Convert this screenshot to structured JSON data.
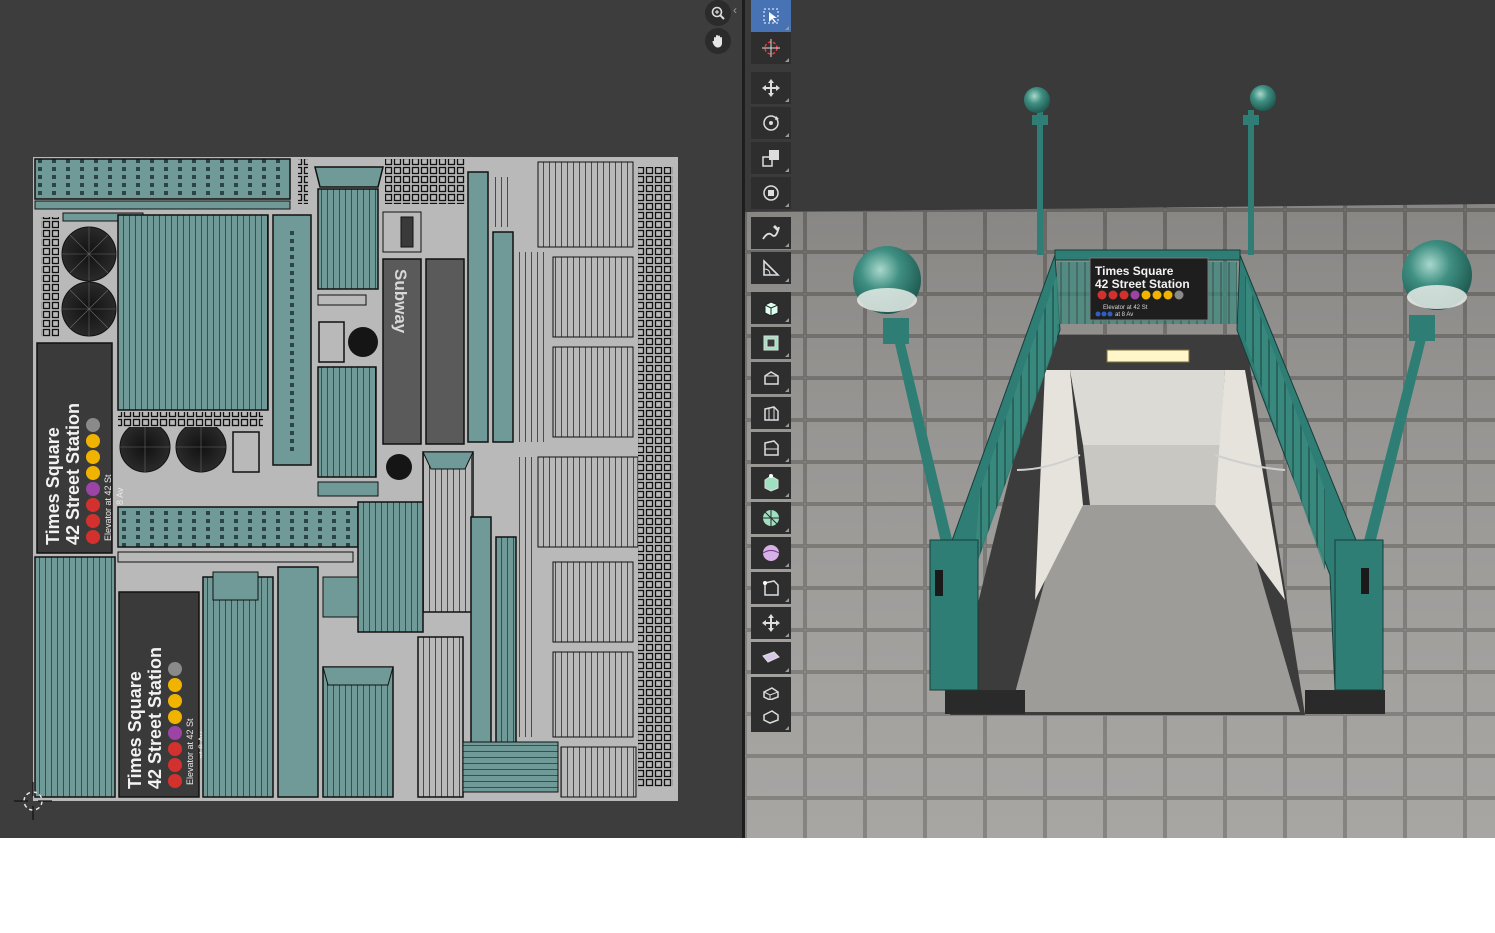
{
  "uv_editor": {
    "nav_buttons": [
      {
        "name": "zoom",
        "icon": "zoom-icon"
      },
      {
        "name": "pan",
        "icon": "hand-icon"
      }
    ],
    "sheet_background": "#b9b9b9",
    "uv_color": "#6f9a98",
    "sign_main": {
      "line1": "Times Square",
      "line2": "42 Street Station",
      "lines_a": [
        "1",
        "2",
        "3",
        "7"
      ],
      "lines_b": [
        "N",
        "Q",
        "R",
        "S"
      ],
      "elevator": "Elevator at 42 St",
      "ace": [
        "A",
        "C",
        "E"
      ],
      "ace_text": "at 8 Av"
    },
    "subway_label": "Subway"
  },
  "viewport": {
    "sign": {
      "line1": "Times Square",
      "line2": "42 Street Station",
      "lines_a": [
        "1",
        "2",
        "3",
        "7"
      ],
      "lines_b": [
        "N",
        "Q",
        "R",
        "S"
      ],
      "elevator": "Elevator at 42 St",
      "ace": [
        "A",
        "C",
        "E"
      ],
      "ace_text": "at 8 Av"
    },
    "colors": {
      "railing": "#2f7e76",
      "globe": "#3f8f82",
      "floor": "#9c9a98",
      "background": "#3a3a3a",
      "active_tool": "#4772b3",
      "line_red": "#d3312e",
      "line_purple": "#9b44a6",
      "line_yellow": "#f0b400",
      "line_grey": "#8a8a8a",
      "line_blue": "#2c5fbf"
    },
    "tools": [
      {
        "name": "select-box",
        "icon": "select-box-icon",
        "active": true
      },
      {
        "name": "cursor",
        "icon": "cursor-icon"
      },
      {
        "name": "move",
        "icon": "move-icon"
      },
      {
        "name": "rotate",
        "icon": "rotate-icon"
      },
      {
        "name": "scale",
        "icon": "scale-icon"
      },
      {
        "name": "transform",
        "icon": "transform-icon"
      },
      {
        "name": "annotate",
        "icon": "annotate-icon"
      },
      {
        "name": "measure",
        "icon": "measure-icon"
      },
      {
        "name": "add-cube",
        "icon": "add-cube-icon"
      },
      {
        "name": "extrude",
        "icon": "extrude-icon"
      },
      {
        "name": "inset",
        "icon": "inset-icon"
      },
      {
        "name": "bevel",
        "icon": "bevel-icon"
      },
      {
        "name": "loop-cut",
        "icon": "loop-cut-icon"
      },
      {
        "name": "knife",
        "icon": "knife-icon"
      },
      {
        "name": "poly-build",
        "icon": "poly-build-icon"
      },
      {
        "name": "spin",
        "icon": "spin-icon"
      },
      {
        "name": "smooth",
        "icon": "smooth-icon"
      },
      {
        "name": "edge-slide",
        "icon": "edge-slide-icon"
      },
      {
        "name": "shrink-fatten",
        "icon": "shrink-fatten-icon"
      },
      {
        "name": "shear",
        "icon": "shear-icon"
      },
      {
        "name": "rip",
        "icon": "rip-icon"
      }
    ]
  }
}
